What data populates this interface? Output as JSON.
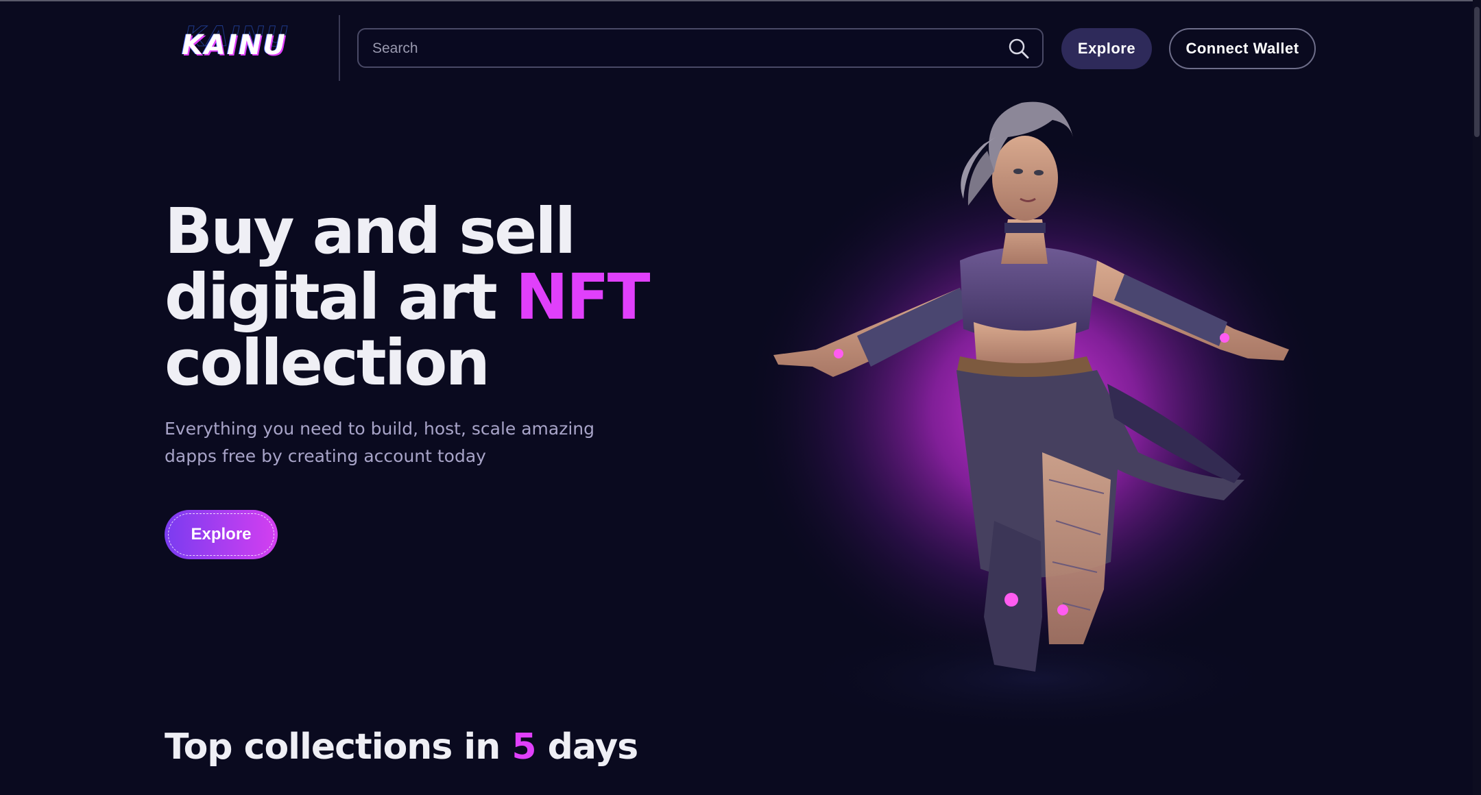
{
  "header": {
    "logo_text": "KAINU",
    "search": {
      "placeholder": "Search",
      "value": ""
    },
    "explore_label": "Explore",
    "connect_wallet_label": "Connect Wallet"
  },
  "hero": {
    "title_line1": "Buy and sell",
    "title_line2_prefix": "digital art ",
    "title_line2_accent": "NFT",
    "title_line3": "collection",
    "subtitle_line1": "Everything you need to build, host, scale amazing",
    "subtitle_line2": "dapps free by creating account today",
    "cta_label": "Explore",
    "artwork": "cyber-dancer-character-render"
  },
  "section": {
    "title_prefix": "Top collections in ",
    "title_number": "5",
    "title_suffix": " days"
  },
  "colors": {
    "background": "#0a0a1f",
    "accent": "#e040fb",
    "gradient_start": "#7a3cf0",
    "gradient_end": "#d43ff0",
    "explore_top_bg": "#2e2a5a"
  },
  "icons": {
    "search": "search-icon",
    "logo": "kainu-logo"
  }
}
